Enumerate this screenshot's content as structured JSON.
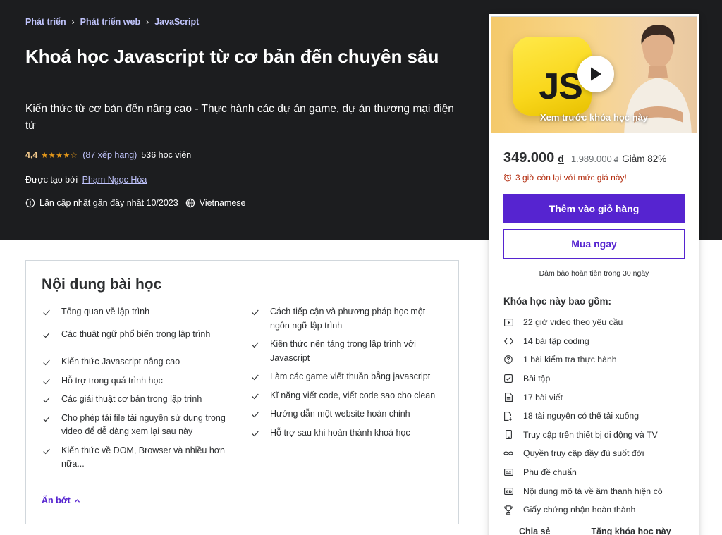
{
  "breadcrumb": [
    "Phát triển",
    "Phát triển web",
    "JavaScript"
  ],
  "course": {
    "title": "Khoá học Javascript từ cơ bản đến chuyên sâu",
    "subtitle": "Kiến thức từ cơ bản đến nâng cao - Thực hành các dự án game, dự án thương mại điện tử",
    "rating": "4,4",
    "rating_stars": 4.4,
    "rating_count_label": "(87 xếp hạng)",
    "students": "536 học viên",
    "created_by_label": "Được tạo bởi",
    "instructor": "Phạm Ngọc Hòa",
    "last_updated": "Lần cập nhật gần đây nhất 10/2023",
    "language": "Vietnamese"
  },
  "learn": {
    "title": "Nội dung bài học",
    "left": [
      "Tổng quan về lập trình",
      "Các thuật ngữ phổ biến trong lập trình",
      "Kiến thức Javascript nâng cao",
      "Hỗ trợ trong quá trình học",
      "Các giải thuật cơ bản trong lập trình",
      "Cho phép tải file tài nguyên sử dụng trong video để dễ dàng xem lại sau này",
      "Kiến thức về DOM, Browser và nhiều hơn nữa..."
    ],
    "right": [
      "Cách tiếp cận và phương pháp học một ngôn ngữ lập trình",
      "Kiến thức nền tảng trong lập trình với Javascript",
      "Làm các game viết thuần bằng javascript",
      "Kĩ năng viết code, viết code sao cho clean",
      "Hướng dẫn một website hoàn chỉnh",
      "Hỗ trợ sau khi hoàn thành khoá học"
    ],
    "show_less": "Ẩn bớt"
  },
  "sidebar": {
    "preview_logo": "JS",
    "preview_label": "Xem trước khóa học này",
    "price": "349.000",
    "currency": "đ",
    "old_price": "1.989.000",
    "discount": "Giảm 82%",
    "countdown": "3 giờ còn lại với mức giá này!",
    "add_to_cart": "Thêm vào giỏ hàng",
    "buy_now": "Mua ngay",
    "guarantee": "Đảm bảo hoàn tiền trong 30 ngày",
    "includes_title": "Khóa học này bao gồm:",
    "includes": [
      {
        "icon": "video-icon",
        "text": "22 giờ video theo yêu cầu"
      },
      {
        "icon": "code-icon",
        "text": "14 bài tập coding"
      },
      {
        "icon": "quiz-icon",
        "text": "1 bài kiểm tra thực hành"
      },
      {
        "icon": "assignment-icon",
        "text": "Bài tập"
      },
      {
        "icon": "article-icon",
        "text": "17 bài viết"
      },
      {
        "icon": "download-file-icon",
        "text": "18 tài nguyên có thể tải xuống"
      },
      {
        "icon": "mobile-icon",
        "text": "Truy cập trên thiết bị di động và TV"
      },
      {
        "icon": "infinity-icon",
        "text": "Quyền truy cập đầy đủ suốt đời"
      },
      {
        "icon": "closed-caption-icon",
        "text": "Phụ đề chuẩn"
      },
      {
        "icon": "audio-description-icon",
        "text": "Nội dung mô tả về âm thanh hiện có"
      },
      {
        "icon": "trophy-icon",
        "text": "Giấy chứng nhận hoàn thành"
      }
    ],
    "share": "Chia sẻ",
    "gift": "Tặng khóa học này"
  },
  "colors": {
    "hero_bg": "#1c1d1f",
    "accent": "#5624d0",
    "link_light": "#c0c4fc",
    "rating": "#f3ca8c",
    "star": "#e59819",
    "alert": "#b32d0f"
  }
}
